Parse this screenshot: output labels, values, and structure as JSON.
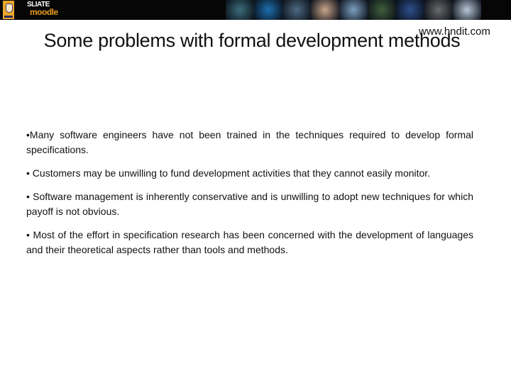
{
  "banner": {
    "brand_line1": "SLIATE",
    "brand_line2": "moodle",
    "colors": {
      "background": "#060606",
      "crest": "#e9a628",
      "brand_accent": "#e79a1c"
    },
    "photo_tiles": [
      "#3a6d7a",
      "#1d6fb0",
      "#4d6a82",
      "#c9a58b",
      "#7b9fc0",
      "#3f5e3a",
      "#2d4f8c",
      "#6a6a6a",
      "#b8c7d8"
    ]
  },
  "slide": {
    "title": "Some problems with formal development methods",
    "watermark": "www.hndit.com",
    "bullets": [
      "•Many software engineers have not been trained in the techniques required to develop formal specifications.",
      "• Customers may be unwilling to fund development activities that they cannot easily monitor.",
      "• Software management is inherently conservative and is unwilling to adopt new techniques for which payoff is not obvious.",
      "• Most of the effort in specification research has been concerned with the development of languages and their theoretical aspects rather than tools and methods."
    ]
  }
}
